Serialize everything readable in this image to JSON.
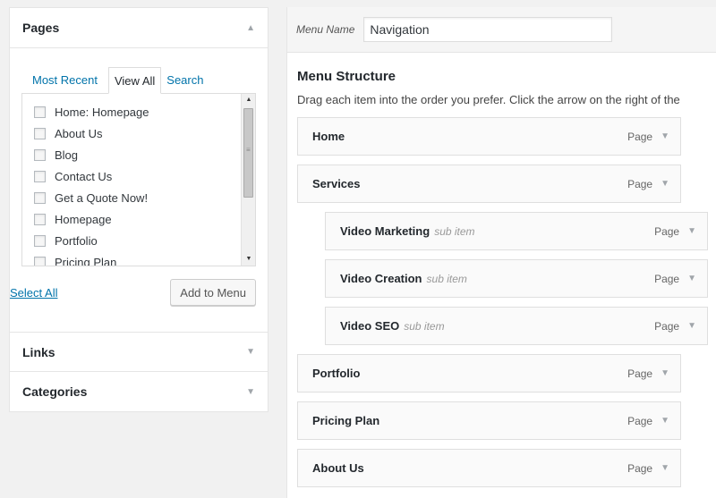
{
  "pages_panel": {
    "title": "Pages",
    "tabs": [
      "Most Recent",
      "View All",
      "Search"
    ],
    "items": [
      "Home: Homepage",
      "About Us",
      "Blog",
      "Contact Us",
      "Get a Quote Now!",
      "Homepage",
      "Portfolio",
      "Pricing Plan"
    ],
    "select_all": "Select All",
    "add_button": "Add to Menu"
  },
  "links_panel": {
    "title": "Links"
  },
  "categories_panel": {
    "title": "Categories"
  },
  "menu": {
    "name_label": "Menu Name",
    "name_value": "Navigation",
    "structure_title": "Menu Structure",
    "structure_hint": "Drag each item into the order you prefer. Click the arrow on the right of the",
    "items": [
      {
        "title": "Home",
        "sub": "",
        "type": "Page"
      },
      {
        "title": "Services",
        "sub": "",
        "type": "Page"
      },
      {
        "title": "Video Marketing",
        "sub": "sub item",
        "type": "Page"
      },
      {
        "title": "Video Creation",
        "sub": "sub item",
        "type": "Page"
      },
      {
        "title": "Video SEO",
        "sub": "sub item",
        "type": "Page"
      },
      {
        "title": "Portfolio",
        "sub": "",
        "type": "Page"
      },
      {
        "title": "Pricing Plan",
        "sub": "",
        "type": "Page"
      },
      {
        "title": "About Us",
        "sub": "",
        "type": "Page"
      }
    ]
  },
  "colors": {
    "link": "#0073aa",
    "panel_bg": "#ffffff",
    "page_bg": "#f1f1f1"
  },
  "icons": {
    "collapse": "triangle-up-icon",
    "expand": "triangle-down-icon"
  }
}
